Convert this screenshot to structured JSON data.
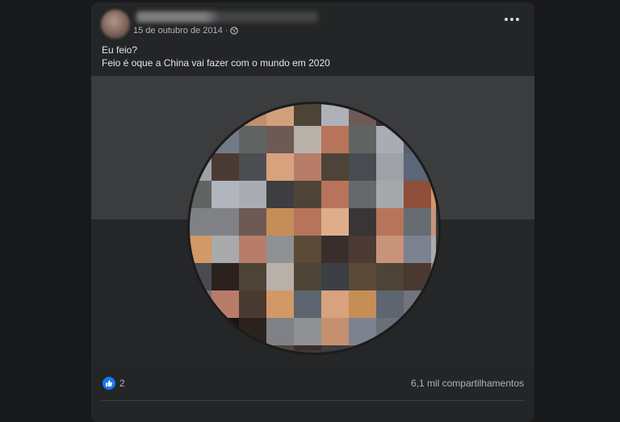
{
  "post": {
    "author": {
      "name": "",
      "name_blurred": true
    },
    "date": "15 de outubro de 2014",
    "separator": "·",
    "privacy_icon": "globe-icon",
    "menu_icon": "more-horizontal-icon",
    "text_lines": [
      "Eu feio?",
      "Feio é oque a China vai fazer com o mundo em 2020"
    ],
    "image": {
      "description": "pixelated circular profile photo",
      "blurred": true
    }
  },
  "footer": {
    "reaction_icon": "like-icon",
    "reaction_count": "2",
    "shares": "6,1 mil compartilhamentos"
  },
  "colors": {
    "page_bg": "#18191a",
    "card_bg": "#242526",
    "text_primary": "#e4e6eb",
    "text_secondary": "#b0b3b8",
    "like_blue": "#1877f2"
  }
}
